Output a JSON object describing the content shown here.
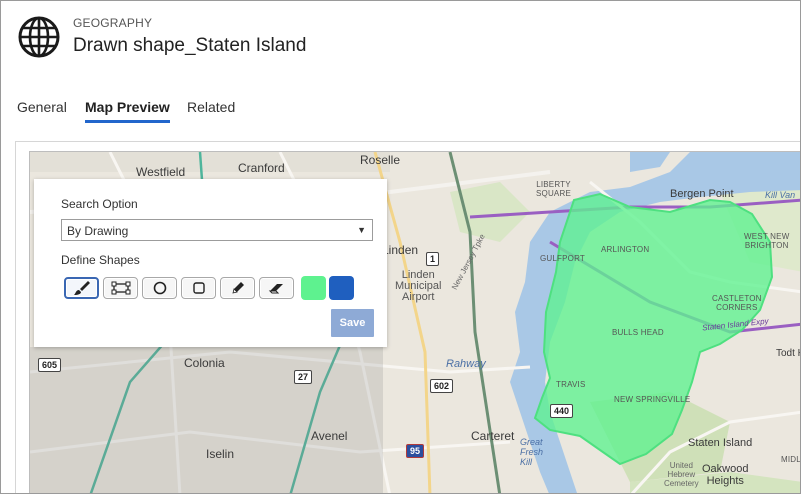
{
  "header": {
    "entity_type": "GEOGRAPHY",
    "title": "Drawn shape_Staten Island",
    "icon": "globe-icon"
  },
  "tabs": [
    {
      "label": "General",
      "active": false
    },
    {
      "label": "Map Preview",
      "active": true
    },
    {
      "label": "Related",
      "active": false
    }
  ],
  "panel": {
    "search_option_label": "Search Option",
    "search_option_value": "By Drawing",
    "define_shapes_label": "Define Shapes",
    "tools": [
      "brush-icon",
      "transform-icon",
      "circle-icon",
      "rectangle-icon",
      "pencil-icon",
      "eraser-icon"
    ],
    "fill_color": "#5ef28f",
    "stroke_color": "#1f5fbf",
    "save_label": "Save"
  },
  "map": {
    "shape_color": "#5ef28f",
    "labels": {
      "roselle": "Roselle",
      "cranford": "Cranford",
      "westfield": "Westfield",
      "linden": "Linden",
      "linden_airport": "Linden\nMunicipal\nAirport",
      "rahway": "Rahway",
      "rahway_river": "Rahway",
      "colonia": "Colonia",
      "avenel": "Avenel",
      "iselin": "Iselin",
      "carteret": "Carteret",
      "fresh_kill": "Great\nFresh\nKill",
      "liberty_square": "LIBERTY\nSQUARE",
      "gulfport": "GULFPORT",
      "arlington": "ARLINGTON",
      "bergen_point": "Bergen Point",
      "kill_van_kull": "Kill Van",
      "west_new_brighton": "WEST NEW\nBRIGHTON",
      "castleton_corners": "CASTLETON\nCORNERS",
      "bulls_head": "BULLS HEAD",
      "staten_island_expy": "Staten Island Expy",
      "travis": "TRAVIS",
      "new_springville": "NEW SPRINGVILLE",
      "staten_island": "Staten Island",
      "todt_hill": "Todt Hil",
      "oakwood_heights": "Oakwood\nHeights",
      "united_hebrew_cemetery": "United\nHebrew\nCemetery",
      "midland": "MIDLA",
      "new_jersey_turnpike": "New Jersey Tpke"
    },
    "shields": {
      "us1": "1",
      "rt27": "27",
      "rt602": "602",
      "rt605": "605",
      "rt440": "440",
      "i95": "95"
    }
  }
}
